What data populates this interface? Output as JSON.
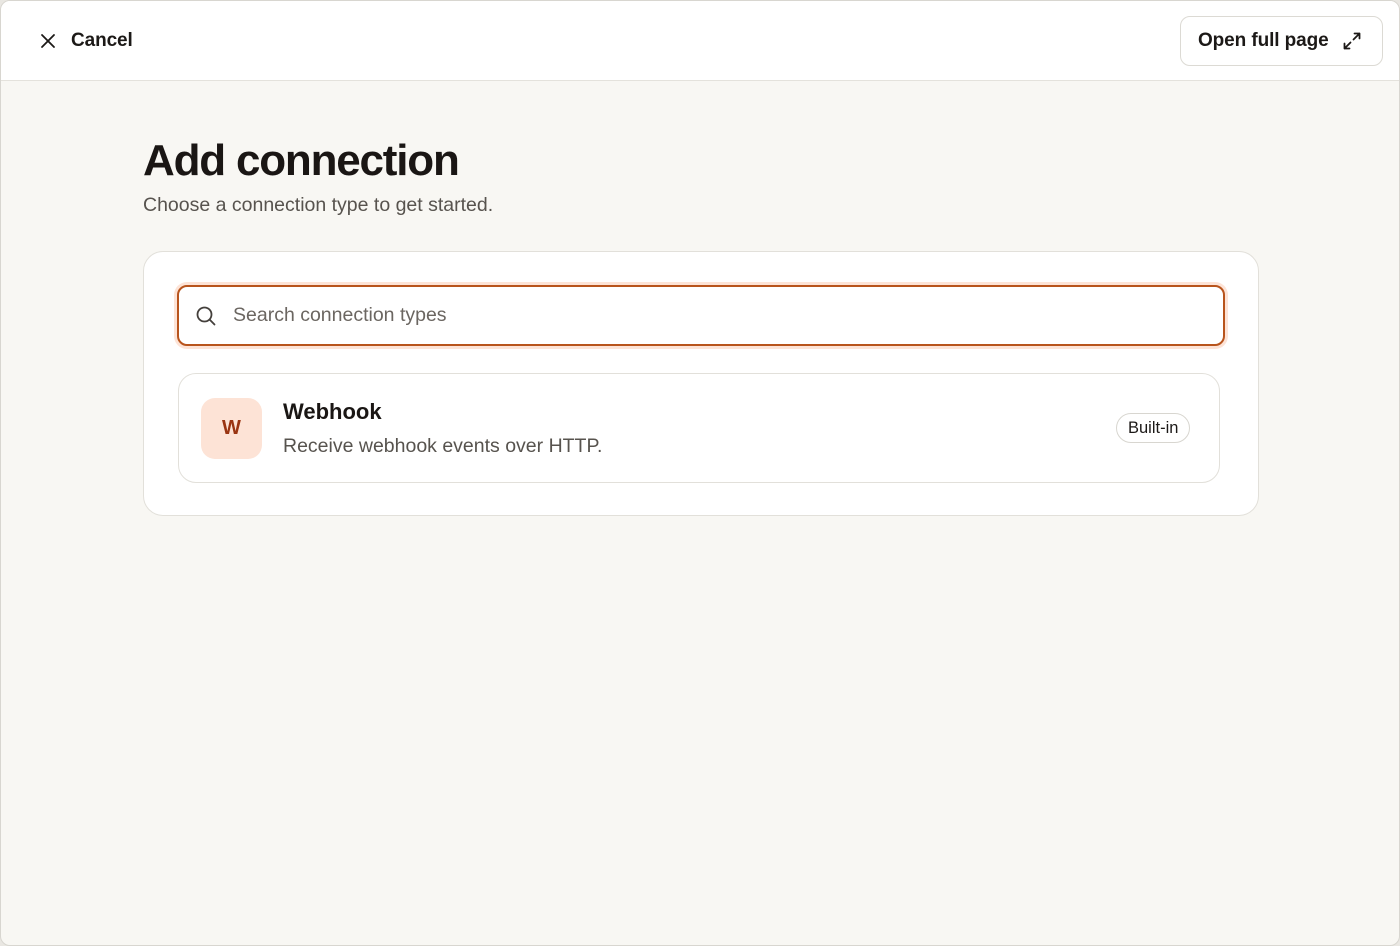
{
  "header": {
    "cancel_label": "Cancel",
    "cancel_icon": "close-icon",
    "open_full_label": "Open full page",
    "open_full_icon": "expand-icon"
  },
  "main": {
    "title": "Add connection",
    "subtitle": "Choose a connection type to get started.",
    "search": {
      "placeholder": "Search connection types",
      "value": "",
      "icon": "search-icon"
    },
    "results": [
      {
        "avatar_letter": "W",
        "name": "Webhook",
        "description": "Receive webhook events over HTTP.",
        "badge": "Built-in"
      }
    ]
  },
  "colors": {
    "accent": "#b8541c",
    "accent_soft": "#fde3d6",
    "avatar_text": "#9a3412",
    "page_background": "#f8f7f3"
  }
}
